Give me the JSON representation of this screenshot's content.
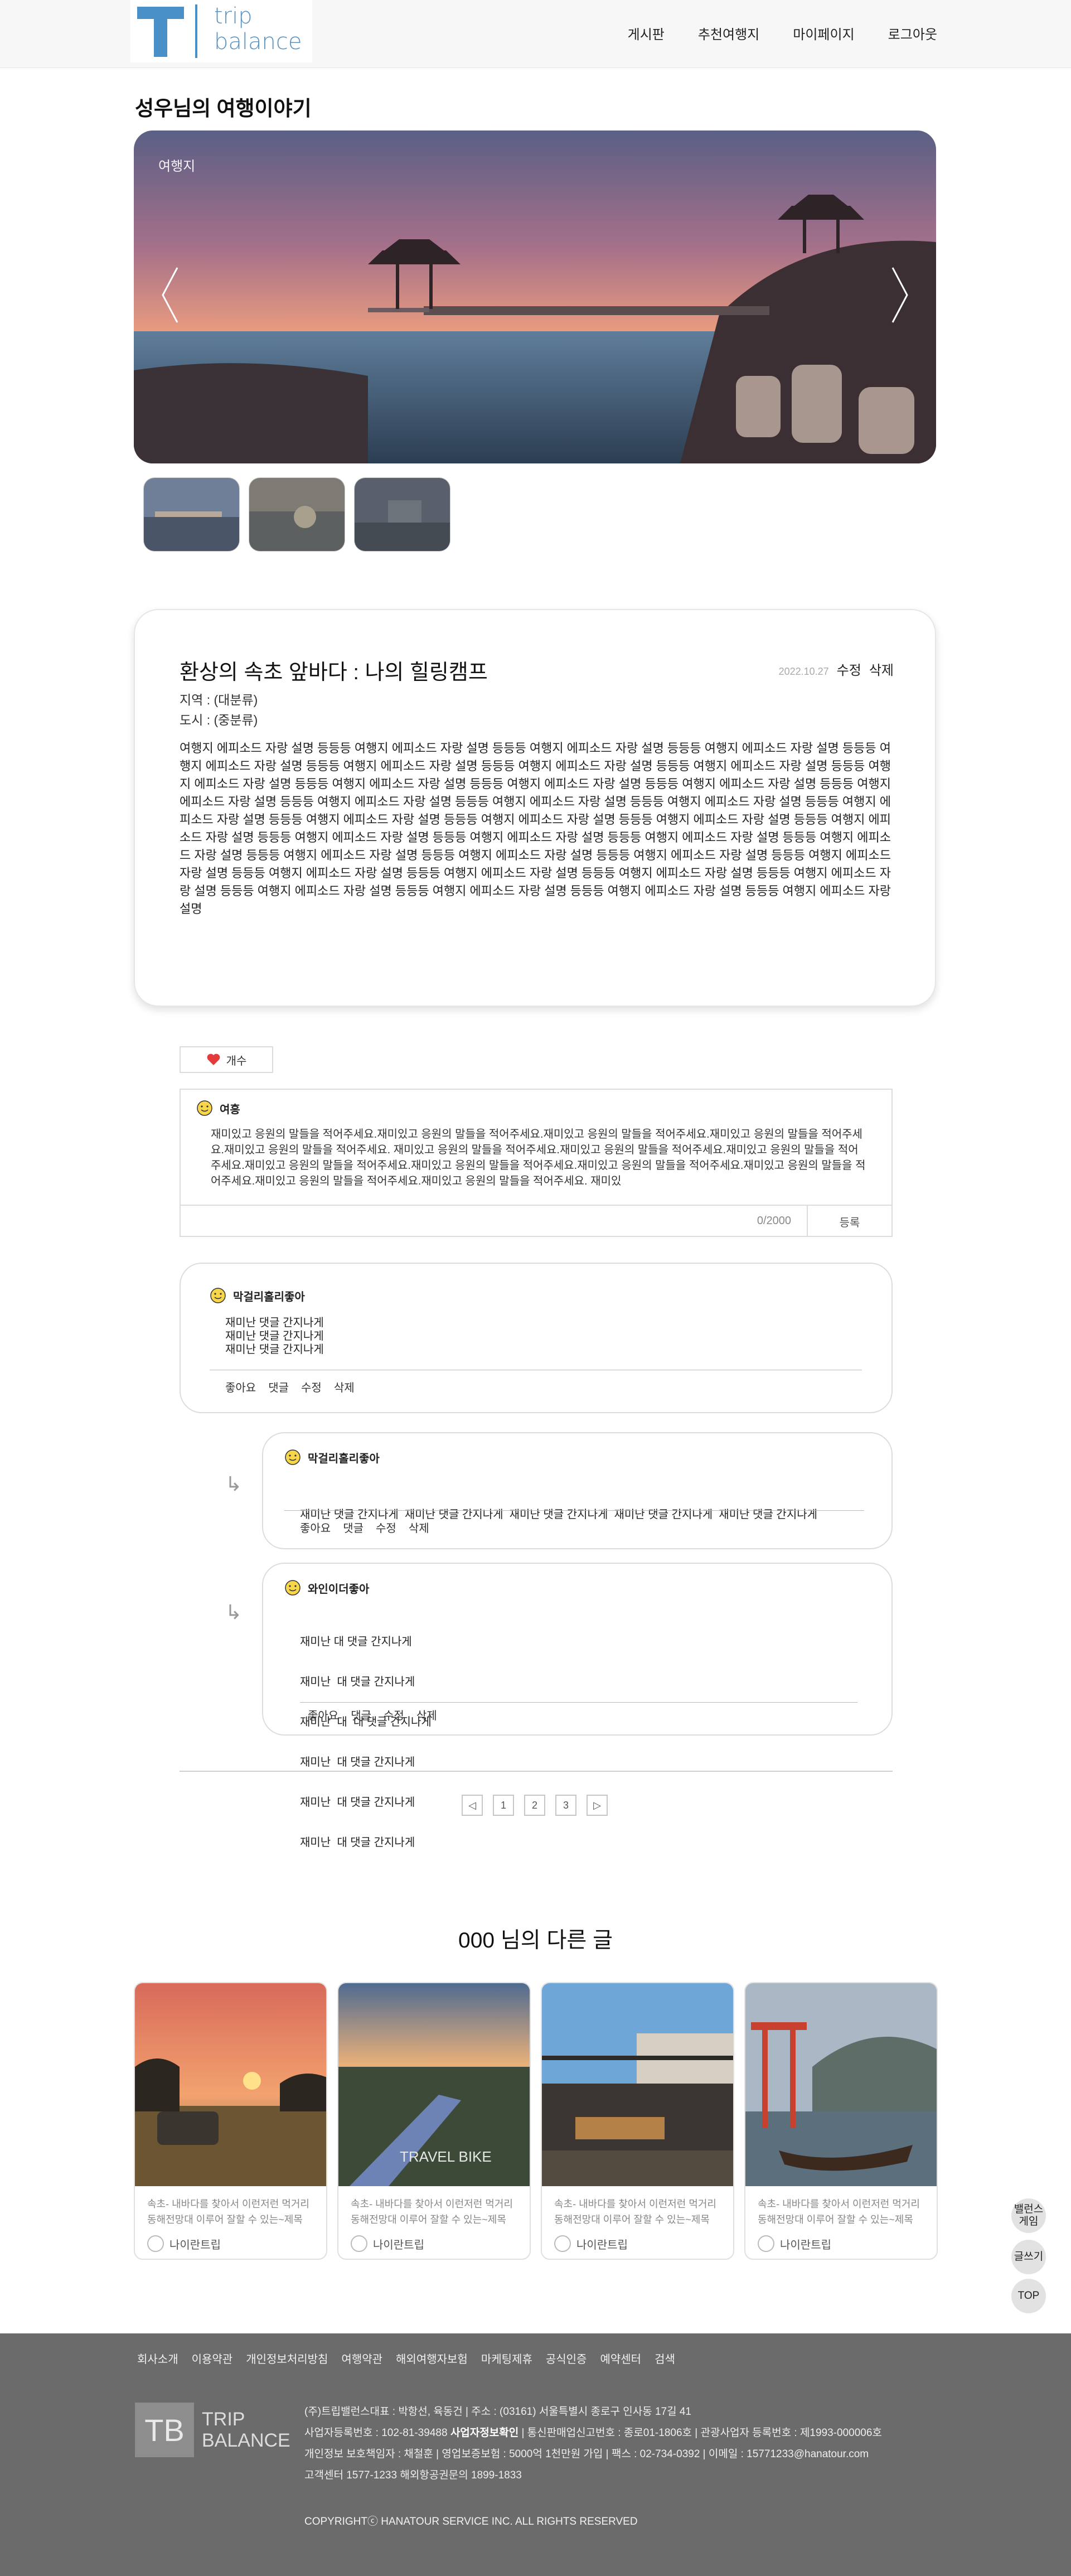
{
  "header": {
    "logo_line1": "trip",
    "logo_line2": "balance",
    "nav": [
      "게시판",
      "추천여행지",
      "마이페이지",
      "로그아웃"
    ]
  },
  "page_title": "성우님의 여행이야기",
  "hero": {
    "label": "여행지"
  },
  "article": {
    "title": "환상의 속초 앞바다 : 나의 힐링캠프",
    "date": "2022.10.27",
    "edit": "수정",
    "delete": "삭제",
    "region": "지역 : (대분류)",
    "city": "도시 : (중분류)",
    "body": "여행지 에피소드 자랑 설명 등등등 여행지 에피소드 자랑 설명 등등등 여행지 에피소드 자랑 설명 등등등 여행지 에피소드 자랑 설명 등등등 여행지 에피소드 자랑 설명 등등등 여행지 에피소드 자랑 설명 등등등 여행지 에피소드 자랑 설명 등등등 여행지 에피소드 자랑 설명 등등등 여행지 에피소드 자랑 설명 등등등 여행지 에피소드 자랑 설명 등등등 여행지 에피소드 자랑 설명 등등등 여행지 에피소드 자랑 설명 등등등 여행지 에피소드 자랑 설명 등등등 여행지 에피소드 자랑 설명 등등등 여행지 에피소드 자랑 설명 등등등 여행지 에피소드 자랑 설명 등등등 여행지 에피소드 자랑 설명 등등등 여행지 에피소드 자랑 설명 등등등 여행지 에피소드 자랑 설명 등등등 여행지 에피소드 자랑 설명 등등등 여행지 에피소드 자랑 설명 등등등 여행지 에피소드 자랑 설명 등등등 여행지 에피소드 자랑 설명 등등등 여행지 에피소드 자랑 설명 등등등 여행지 에피소드 자랑 설명 등등등 여행지 에피소드 자랑 설명 등등등 여행지 에피소드 자랑 설명 등등등 여행지 에피소드 자랑 설명 등등등 여행지 에피소드 자랑 설명 등등등 여행지 에피소드 자랑 설명 등등등 여행지 에피소드 자랑 설명 등등등 여행지 에피소드 자랑 설명 등등등 여행지 에피소드 자랑 설명 등등등 여행지 에피소드 자랑 설명 등등등 여행지 에피소드 자랑 설명 등등등 여행지 에피소드 자랑 설명 등등등 여행지 에피소드 자랑 설명"
  },
  "likes": {
    "label": "개수"
  },
  "editor": {
    "author": "여흥",
    "text": "재미있고 응원의 말들을 적어주세요.재미있고 응원의 말들을 적어주세요.재미있고 응원의 말들을 적어주세요.재미있고 응원의 말들을 적어주세요.재미있고 응원의 말들을 적어주세요. 재미있고 응원의 말들을 적어주세요.재미있고 응원의 말들을 적어주세요.재미있고 응원의 말들을 적어주세요.재미있고 응원의 말들을 적어주세요.재미있고 응원의 말들을 적어주세요.재미있고 응원의 말들을 적어주세요.재미있고 응원의 말들을 적어주세요.재미있고 응원의 말들을 적어주세요.재미있고 응원의 말들을 적어주세요. 재미있",
    "count": "0/2000",
    "submit": "등록"
  },
  "comments": [
    {
      "author": "막걸리홀리좋아",
      "lines": [
        "재미난 댓글 간지나게",
        "재미난 댓글 간지나게",
        "재미난 댓글 간지나게"
      ],
      "actions": [
        "좋아요",
        "댓글",
        "수정",
        "삭제"
      ]
    },
    {
      "author": "막걸리홀리좋아",
      "lines": [
        "재미난 댓글 간지나게  재미난 댓글 간지나게  재미난 댓글 간지나게  재미난 댓글 간지나게  재미난 댓글 간지나게"
      ],
      "actions": [
        "좋아요",
        "댓글",
        "수정",
        "삭제"
      ]
    },
    {
      "author": "와인이더좋아",
      "lines": [
        "재미난 대 댓글 간지나게",
        "재미난  대 댓글 간지나게",
        "재미난  대  대 댓글 간지나게",
        "재미난  대 댓글 간지나게",
        "재미난  대 댓글 간지나게",
        "재미난  대 댓글 간지나게"
      ],
      "actions": [
        "좋아요",
        "댓글",
        "수정",
        "삭제"
      ]
    }
  ],
  "pager": [
    "1",
    "2",
    "3"
  ],
  "other": {
    "title": "000 님의 다른 글",
    "cards": [
      {
        "desc": "속초- 내바다를 찾아서 이런저런 먹거리 동해전망대 이루어 잘할 수 있는~제목",
        "author": "나이란트립"
      },
      {
        "desc": "속초- 내바다를 찾아서 이런저런 먹거리 동해전망대 이루어 잘할 수 있는~제목",
        "author": "나이란트립"
      },
      {
        "desc": "속초- 내바다를 찾아서 이런저런 먹거리 동해전망대 이루어 잘할 수 있는~제목",
        "author": "나이란트립"
      },
      {
        "desc": "속초- 내바다를 찾아서 이런저런 먹거리 동해전망대 이루어 잘할 수 있는~제목",
        "author": "나이란트립"
      }
    ],
    "card2_watermark": "TRAVEL BIKE"
  },
  "floating": {
    "balance": "밸런스 게임",
    "write": "글쓰기",
    "top": "TOP"
  },
  "footer": {
    "links": [
      "회사소개",
      "이용약관",
      "개인정보처리방침",
      "여행약관",
      "해외여행자보험",
      "마케팅제휴",
      "공식인증",
      "예약센터",
      "검색"
    ],
    "logo_mark": "TB",
    "logo_line1": "TRIP",
    "logo_line2": "BALANCE",
    "info1": "(주)트립밸런스대표 : 박항선, 육동건 | 주소 : (03161) 서울특별시 종로구 인사동 17길 41",
    "info2_a": "사업자등록번호 : 102-81-39488 ",
    "info2_b": "사업자정보확인",
    "info2_c": " | 통신판매업신고번호 : 종로01-1806호 | 관광사업자 등록번호 : 제1993-000006호",
    "info3": "개인정보 보호책임자 : 채철훈 | 영업보증보험 : 5000억 1천만원 가입 | 팩스 : 02-734-0392 | 이메일 : 15771233@hanatour.com",
    "info4": "고객센터 1577-1233    해외항공권문의 1899-1833",
    "copyright": "COPYRIGHTⓒ HANATOUR SERVICE INC. ALL RIGHTS RESERVED"
  }
}
